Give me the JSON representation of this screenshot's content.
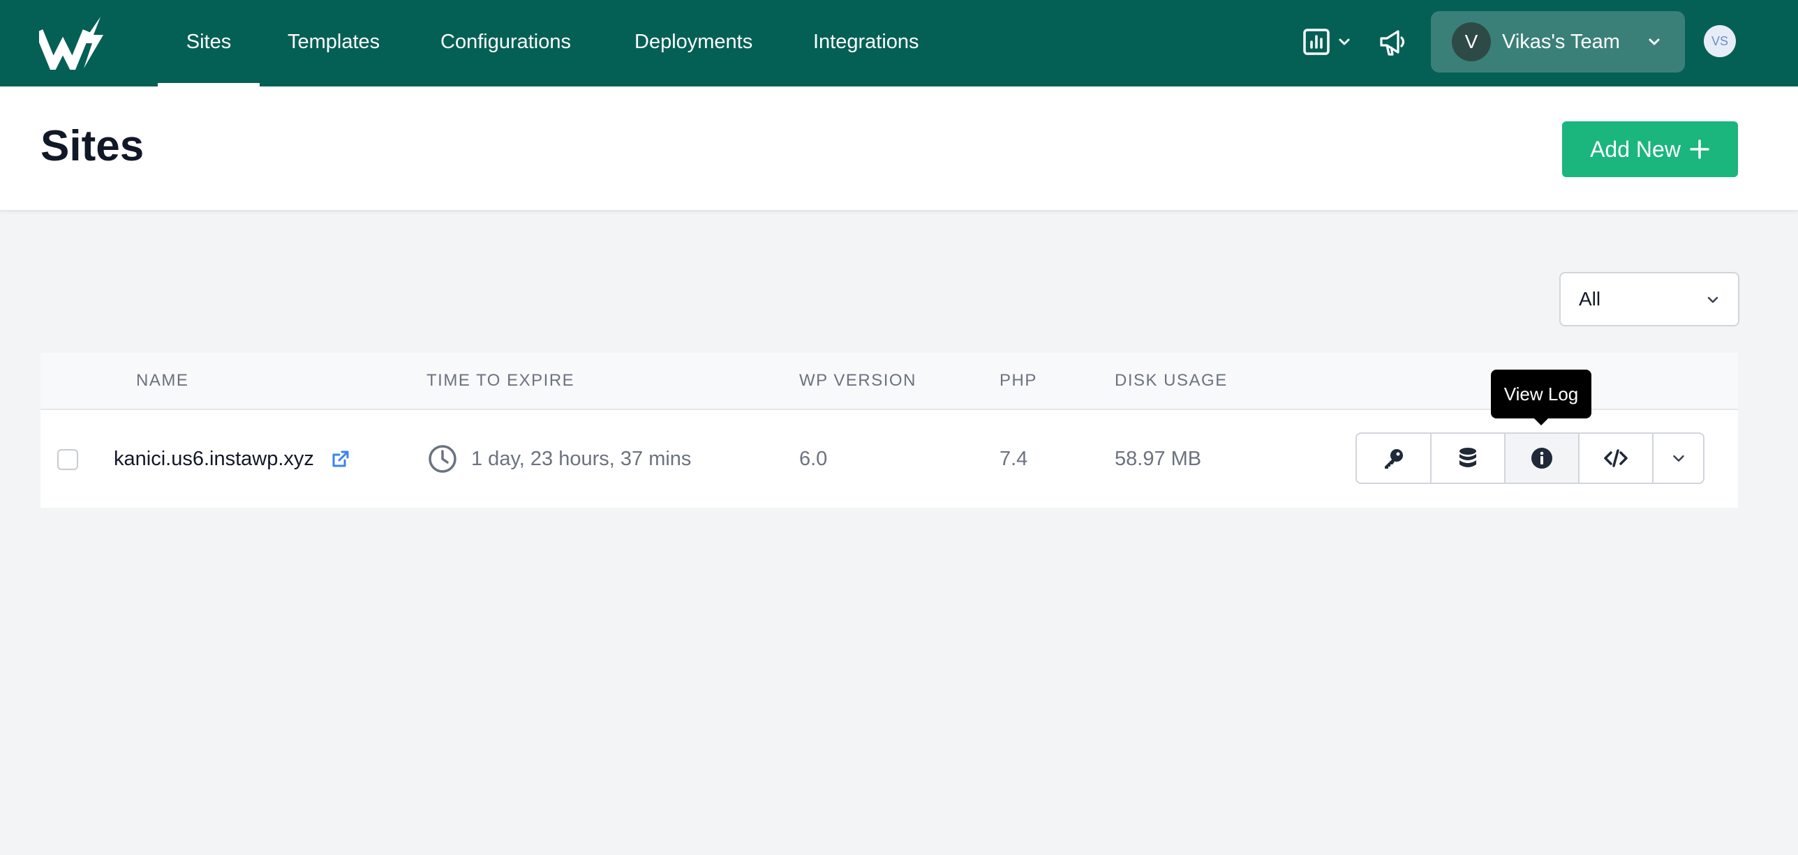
{
  "nav": {
    "items": [
      {
        "label": "Sites",
        "active": true
      },
      {
        "label": "Templates"
      },
      {
        "label": "Configurations"
      },
      {
        "label": "Deployments"
      },
      {
        "label": "Integrations"
      }
    ],
    "team": {
      "initial": "V",
      "name": "Vikas's Team"
    },
    "user_initials": "VS",
    "icons": [
      "logo-icon",
      "report-icon",
      "chevron-down-icon",
      "megaphone-icon"
    ]
  },
  "header": {
    "title": "Sites",
    "add_new_label": "Add New"
  },
  "filter": {
    "selected": "All"
  },
  "table": {
    "columns": [
      "NAME",
      "TIME TO EXPIRE",
      "WP VERSION",
      "PHP",
      "DISK USAGE"
    ],
    "rows": [
      {
        "name": "kanici.us6.instawp.xyz",
        "time_to_expire": "1 day, 23 hours, 37 mins",
        "wp_version": "6.0",
        "php": "7.4",
        "disk_usage": "58.97 MB"
      }
    ],
    "action_icons": [
      "key-icon",
      "database-icon",
      "info-icon",
      "code-icon",
      "chevron-down-icon"
    ]
  },
  "tooltip": {
    "text": "View Log"
  },
  "colors": {
    "topbar": "#046055",
    "accent_button": "#1bb57e",
    "team_switcher": "#3b8078",
    "link_icon": "#3b82f6"
  }
}
